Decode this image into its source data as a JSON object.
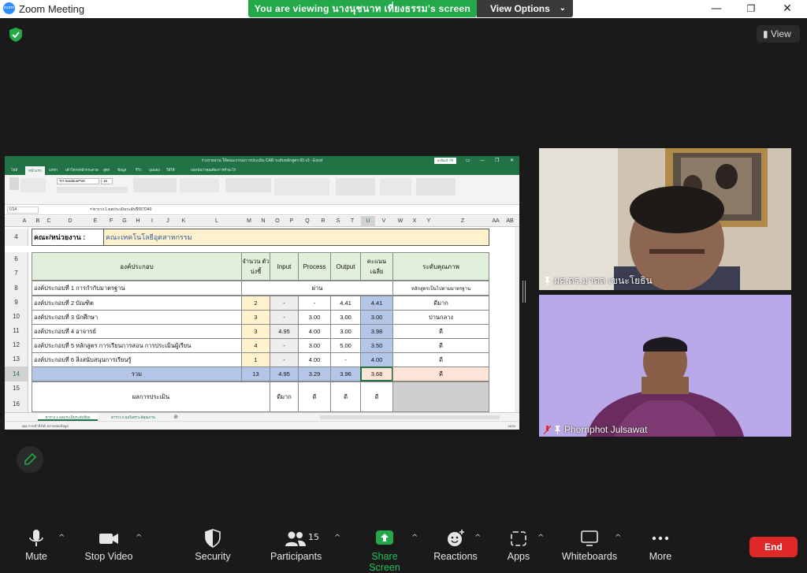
{
  "window": {
    "title": "Zoom Meeting",
    "app_logo_text": "zoom"
  },
  "share_banner": {
    "text": "You are viewing นางนุชนาท เที่ยงธรรม's screen",
    "view_options_label": "View Options"
  },
  "view_button": {
    "label": "View"
  },
  "excel": {
    "title": "ร่างรายงาน ให้คณะกรรมการประเมิน CAR ระดับหลักสูตร 65 v3 - Excel",
    "account_label": "ลงชื่อเข้าใช้",
    "tabs": [
      "ไฟล์",
      "หน้าแรก",
      "แทรก",
      "เค้าโครงหน้ากระดาษ",
      "สูตร",
      "ข้อมูล",
      "รีวิว",
      "มุมมอง",
      "วิธีใช้",
      "บอกฉันว่าคุณต้องการทำอะไร"
    ],
    "font_name": "TH SarabunPSK",
    "font_size": "16",
    "name_box": "U14",
    "formula": "='ตาราง 1 ผลประเมินระดับปี65'!D40",
    "column_headers": [
      "A",
      "B",
      "C",
      "D",
      "E",
      "F",
      "G",
      "H",
      "I",
      "J",
      "K",
      "L",
      "M",
      "N",
      "O",
      "P",
      "Q",
      "R",
      "S",
      "T",
      "U",
      "V",
      "W",
      "X",
      "Y",
      "Z",
      "AA",
      "AB"
    ],
    "rows": {
      "r4": {
        "num": "4",
        "label": "คณะ/หน่วยงาน :",
        "value": "คณะเทคโนโลยีอุตสาหกรรม"
      },
      "r6": {
        "num": "6"
      },
      "r7": {
        "num": "7"
      },
      "header": {
        "component": "องค์ประกอบ",
        "indicator_count": "จำนวน ตัวบ่งชี้",
        "input": "Input",
        "process": "Process",
        "output": "Output",
        "avg_score": "คะแนน เฉลี่ย",
        "quality": "ระดับคุณภาพ"
      },
      "data": [
        {
          "num": "8",
          "name": "องค์ประกอบที่ 1 การกำกับมาตรฐาน",
          "count": "",
          "input": "",
          "process": "ผ่าน",
          "output": "",
          "avg": "",
          "quality": "หลักสูตรเป็นไปตามมาตรฐาน"
        },
        {
          "num": "9",
          "name": "องค์ประกอบที่ 2 บัณฑิต",
          "count": "2",
          "input": "-",
          "process": "-",
          "output": "4.41",
          "avg": "4.41",
          "quality": "ดีมาก"
        },
        {
          "num": "10",
          "name": "องค์ประกอบที่ 3 นักศึกษา",
          "count": "3",
          "input": "-",
          "process": "3.00",
          "output": "3.00",
          "avg": "3.00",
          "quality": "ปานกลาง"
        },
        {
          "num": "11",
          "name": "องค์ประกอบที่ 4 อาจารย์",
          "count": "3",
          "input": "4.95",
          "process": "4.00",
          "output": "3.00",
          "avg": "3.98",
          "quality": "ดี"
        },
        {
          "num": "12",
          "name": "องค์ประกอบที่ 5 หลักสูตร การเรียนการสอน การประเมินผู้เรียน",
          "count": "4",
          "input": "-",
          "process": "3.00",
          "output": "5.00",
          "avg": "3.50",
          "quality": "ดี"
        },
        {
          "num": "13",
          "name": "องค์ประกอบที่ 6 สิ่งสนับสนุนการเรียนรู้",
          "count": "1",
          "input": "-",
          "process": "4.00",
          "output": "-",
          "avg": "4.00",
          "quality": "ดี"
        }
      ],
      "total": {
        "num": "14",
        "label": "รวม",
        "count": "13",
        "input": "4.95",
        "process": "3.29",
        "output": "3.96",
        "avg": "3.68",
        "quality": "ดี"
      },
      "result": {
        "num15": "15",
        "num16": "16",
        "label": "ผลการประเมิน",
        "input": "ดีมาก",
        "process": "ดี",
        "output": "ดี",
        "avg": "ดี"
      }
    },
    "sheet_tabs": [
      "ตาราง 1 ผลประเมินระดับปี65",
      "ตาราง 2 ผลวิเคราะห์คุณภาพ"
    ],
    "status_text": "คุณ การเข้าถึงได้: ตรวจสอบข้อมูล",
    "zoom_level": "140%"
  },
  "participants_video": [
    {
      "name": "ผศ.ดร.มาดล เขนะโยธิน"
    },
    {
      "name": "Phornphot Julsawat"
    }
  ],
  "toolbar": {
    "mute": "Mute",
    "stop_video": "Stop Video",
    "security": "Security",
    "participants": "Participants",
    "participants_count": "15",
    "share_screen": "Share Screen",
    "reactions": "Reactions",
    "apps": "Apps",
    "whiteboards": "Whiteboards",
    "more": "More",
    "end": "End"
  },
  "colors": {
    "zoom_green": "#23a94a",
    "excel_green": "#217346",
    "end_red": "#e02828"
  }
}
